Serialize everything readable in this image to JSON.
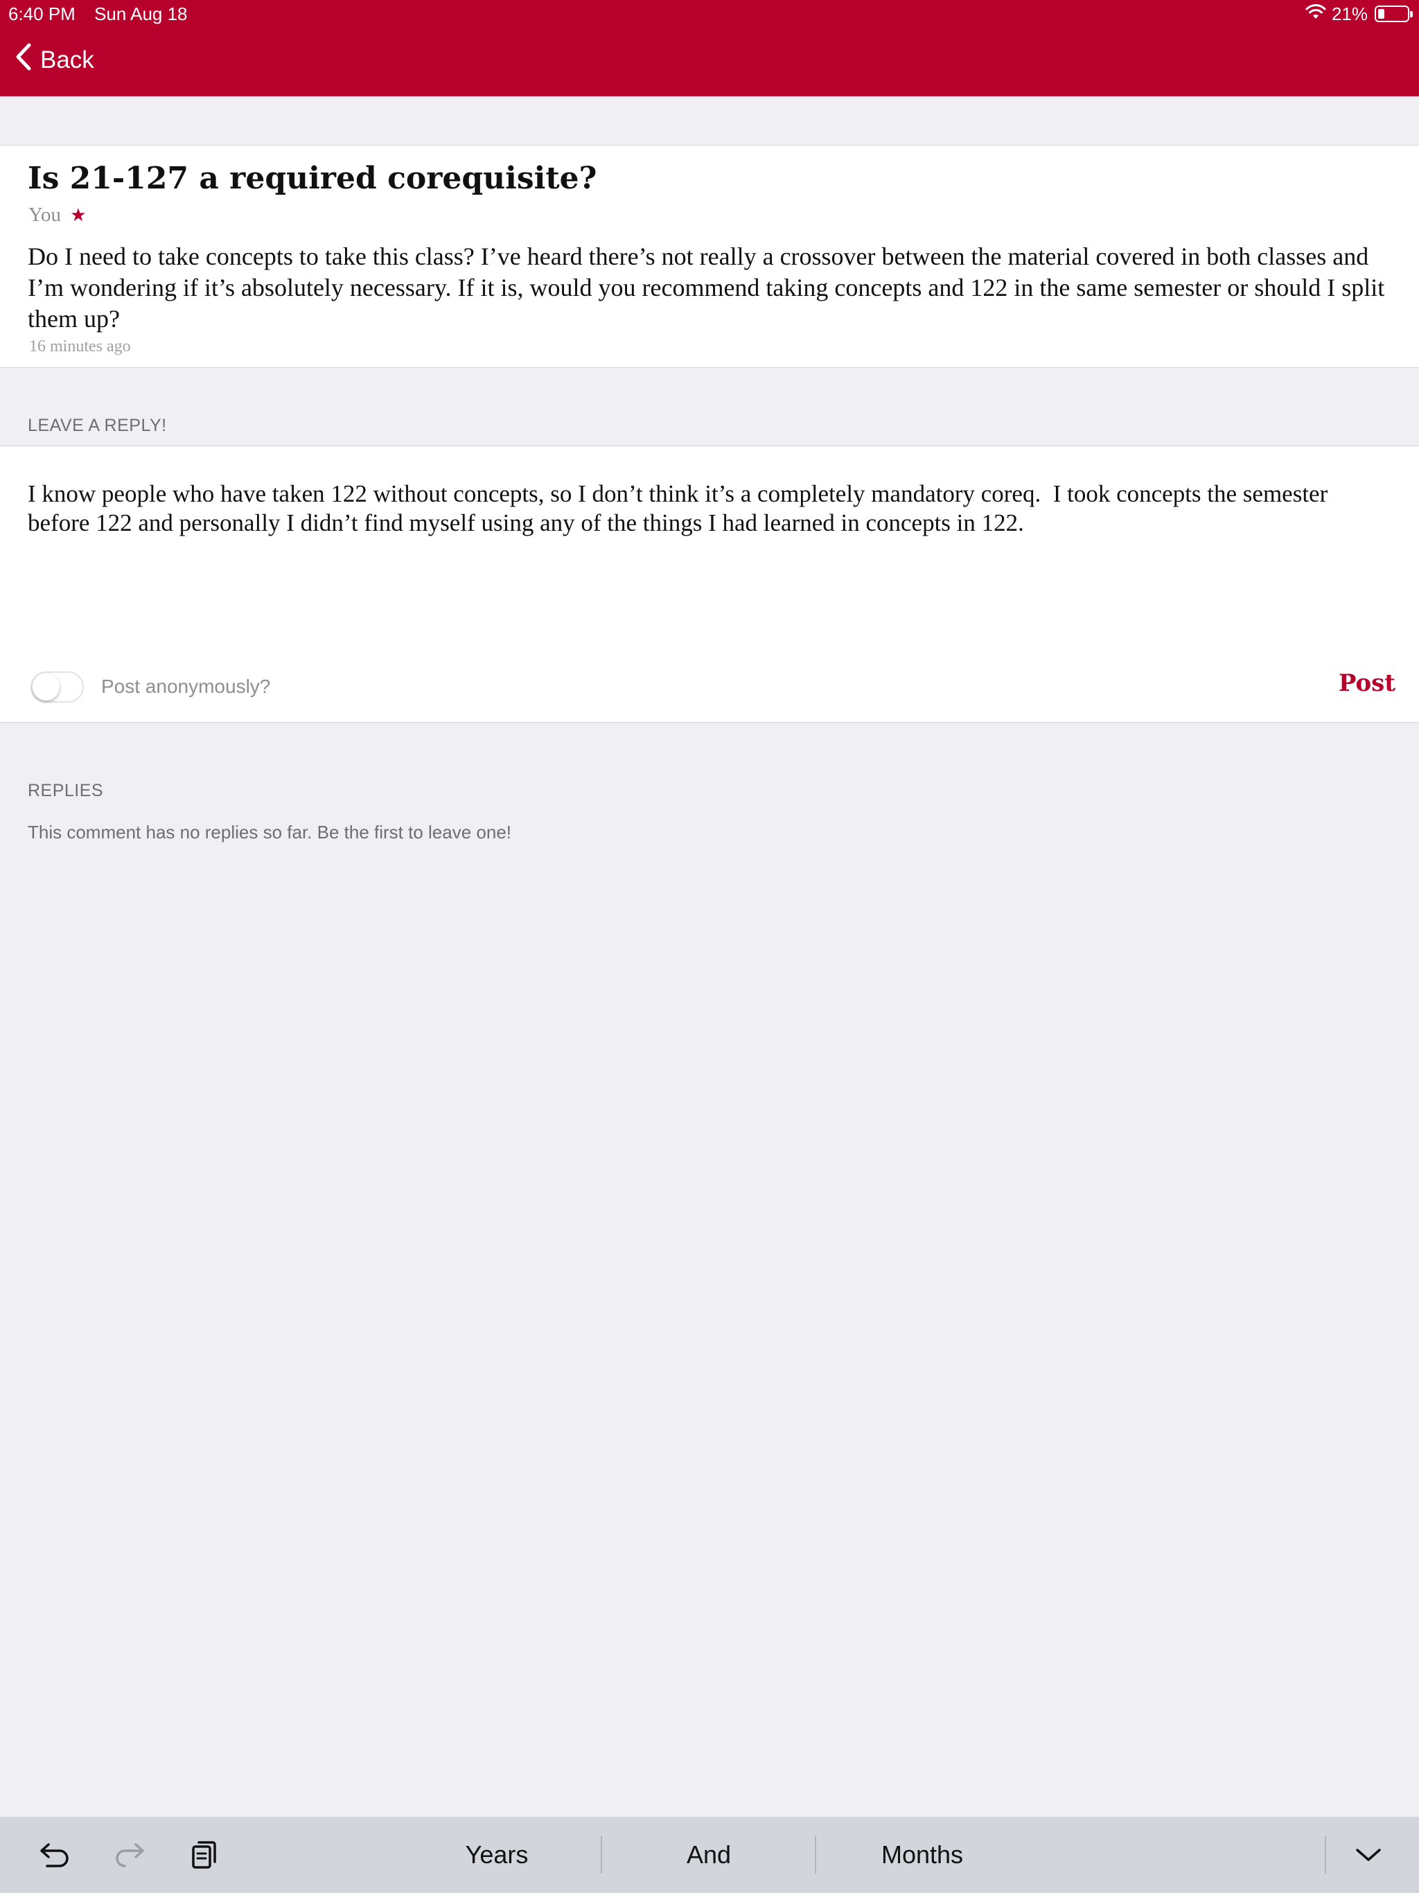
{
  "status_bar": {
    "time": "6:40 PM",
    "date": "Sun Aug 18",
    "battery": "21%",
    "battery_level": 0.21,
    "icons": [
      "wifi-icon",
      "battery-icon"
    ]
  },
  "nav": {
    "back_label": "Back",
    "accent_color": "#b8002c"
  },
  "post": {
    "title": "Is 21-127 a required corequisite?",
    "author": "You",
    "author_badge": "★",
    "body": "Do I need to take concepts to take this class?  I’ve heard there’s not really a crossover between the material covered in both classes and I’m wondering if it’s absolutely necessary.  If it is, would you recommend taking concepts and 122 in the same semester or should I split them up?",
    "timestamp": "16 minutes ago"
  },
  "reply_form": {
    "section_label": "LEAVE A REPLY!",
    "text": "I know people who have taken 122 without concepts, so I don’t think it’s a completely mandatory coreq.  I took concepts the semester before 122 and personally I didn’t find myself using any of the things I had learned in concepts in 122.",
    "anonymous_label": "Post anonymously?",
    "anonymous_on": false,
    "post_label": "Post"
  },
  "replies": {
    "section_label": "REPLIES",
    "empty_message": "This comment has no replies so far.  Be the first to leave one!"
  },
  "keyboard_bar": {
    "icons": [
      "undo-icon",
      "redo-icon",
      "clipboard-icon",
      "dismiss-keyboard-icon"
    ],
    "suggestions": [
      "Years",
      "And",
      "Months"
    ]
  }
}
